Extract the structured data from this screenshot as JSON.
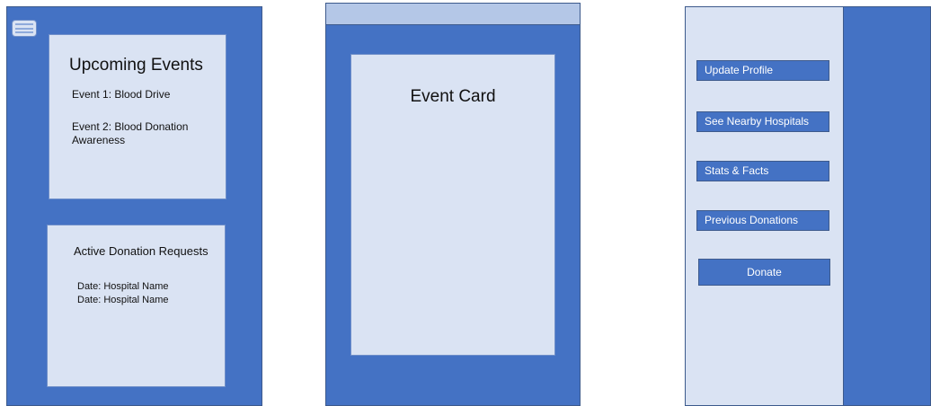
{
  "home": {
    "menu_icon": "hamburger-menu-icon",
    "upcoming_events": {
      "title": "Upcoming Events",
      "items": [
        "Event 1: Blood Drive",
        "Event 2: Blood Donation Awareness"
      ]
    },
    "active_requests": {
      "title": "Active Donation Requests",
      "items": [
        "Date: Hospital Name",
        "Date: Hospital Name"
      ]
    }
  },
  "event_screen": {
    "card_title": "Event Card"
  },
  "menu_screen": {
    "buttons": {
      "update_profile": "Update Profile",
      "nearby_hospitals": "See Nearby Hospitals",
      "stats_facts": "Stats & Facts",
      "previous_donations": "Previous Donations",
      "donate": "Donate"
    }
  },
  "colors": {
    "primary_blue": "#4472c4",
    "light_panel": "#dae3f3",
    "top_bar": "#b4c7e7"
  }
}
